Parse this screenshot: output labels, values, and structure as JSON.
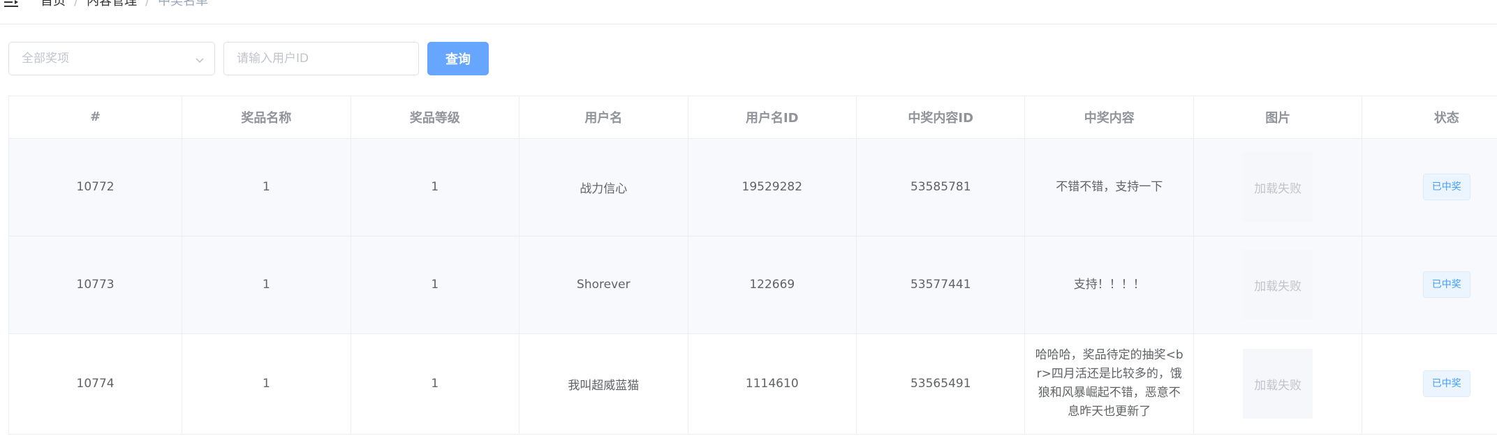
{
  "breadcrumb": {
    "items": [
      "首页",
      "内容管理",
      "中奖名单"
    ],
    "separator": "/"
  },
  "icons": {
    "menu_toggle": "hamburger-icon",
    "select_arrow": "chevron-down-icon"
  },
  "filters": {
    "prize_select_placeholder": "全部奖项",
    "user_id_placeholder": "请输入用户ID",
    "query_button": "查询"
  },
  "table": {
    "columns": [
      "#",
      "奖品名称",
      "奖品等级",
      "用户名",
      "用户名ID",
      "中奖内容ID",
      "中奖内容",
      "图片",
      "状态"
    ],
    "rows": [
      {
        "id": "10772",
        "prize_name": "1",
        "prize_level": "1",
        "username": "战力信心",
        "user_id": "19529282",
        "content_id": "53585781",
        "content": "不错不错，支持一下",
        "image": "加载失败",
        "status": "已中奖"
      },
      {
        "id": "10773",
        "prize_name": "1",
        "prize_level": "1",
        "username": "Shorever",
        "user_id": "122669",
        "content_id": "53577441",
        "content": "支持！！！！",
        "image": "加载失败",
        "status": "已中奖"
      },
      {
        "id": "10774",
        "prize_name": "1",
        "prize_level": "1",
        "username": "我叫超威蓝猫",
        "user_id": "1114610",
        "content_id": "53565491",
        "content": "哈哈哈，奖品待定的抽奖<br>四月活还是比较多的，饿狼和风暴崛起不错，恶意不息昨天也更新了",
        "image": "加载失败",
        "status": "已中奖"
      }
    ]
  },
  "colors": {
    "primary_button": "#66a6ff",
    "tag_text": "#409eff",
    "tag_bg": "#ecf5ff",
    "row_stripe": "#f7f9fc"
  }
}
